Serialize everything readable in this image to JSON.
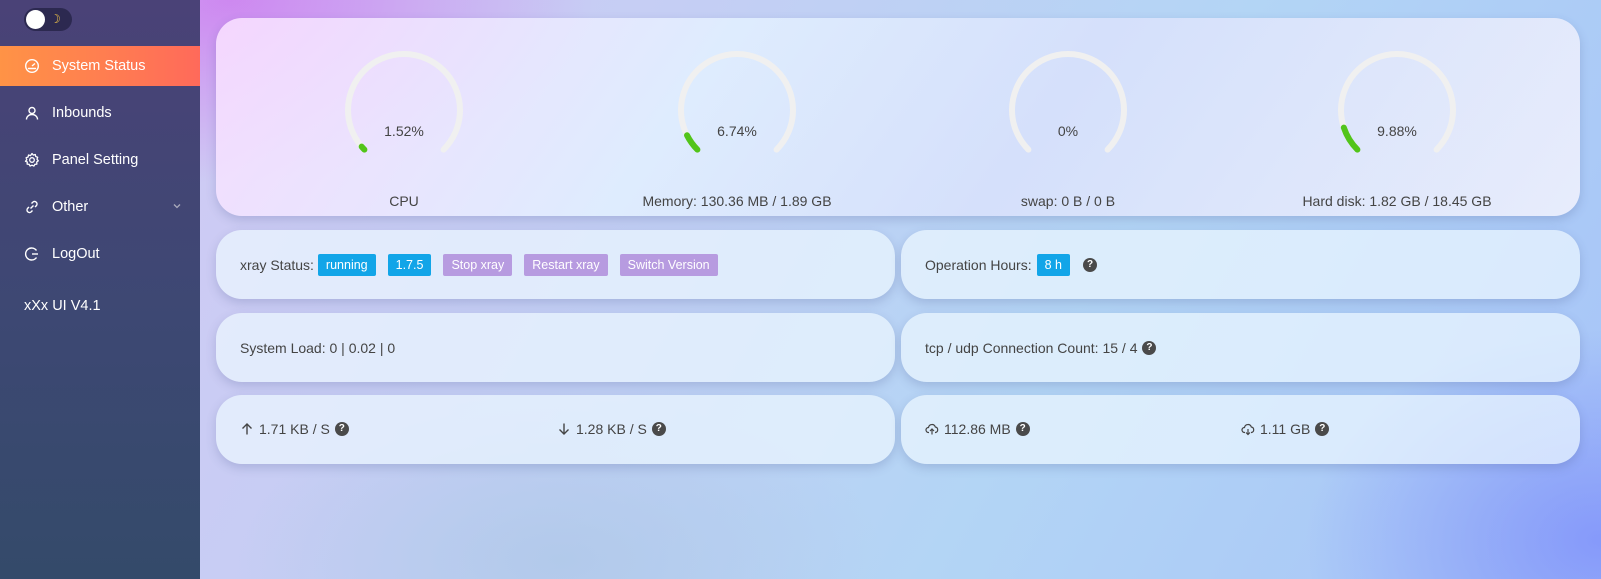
{
  "sidebar": {
    "theme_toggle_icon": "moon-icon",
    "items": [
      {
        "label": "System Status",
        "icon": "dashboard-icon",
        "active": true
      },
      {
        "label": "Inbounds",
        "icon": "user-icon"
      },
      {
        "label": "Panel Setting",
        "icon": "gear-icon"
      },
      {
        "label": "Other",
        "icon": "link-icon",
        "has_submenu": true
      },
      {
        "label": "LogOut",
        "icon": "logout-icon"
      }
    ],
    "version": "xXx UI V4.1"
  },
  "gauges": [
    {
      "value_text": "1.52%",
      "percent": 1.52,
      "label": "CPU"
    },
    {
      "value_text": "6.74%",
      "percent": 6.74,
      "label": "Memory: 130.36 MB / 1.89 GB"
    },
    {
      "value_text": "0%",
      "percent": 0,
      "label": "swap: 0 B / 0 B"
    },
    {
      "value_text": "9.88%",
      "percent": 9.88,
      "label": "Hard disk: 1.82 GB / 18.45 GB"
    }
  ],
  "xray": {
    "label": "xray Status:",
    "status": "running",
    "version": "1.7.5",
    "stop_label": "Stop xray",
    "restart_label": "Restart xray",
    "switch_label": "Switch Version"
  },
  "operation": {
    "label": "Operation Hours:",
    "value": "8 h"
  },
  "system_load": "System Load: 0 | 0.02 | 0",
  "connections": "tcp / udp Connection Count: 15 / 4",
  "speed": {
    "upload": "1.71 KB / S",
    "download": "1.28 KB / S"
  },
  "traffic": {
    "sent": "112.86 MB",
    "received": "1.11 GB"
  },
  "colors": {
    "accent_active": "#ff7a50",
    "tag_blue": "#12a5e8",
    "tag_purple": "#b79be0",
    "gauge_track": "#f0f0f0",
    "gauge_fill": "#52c41a"
  }
}
